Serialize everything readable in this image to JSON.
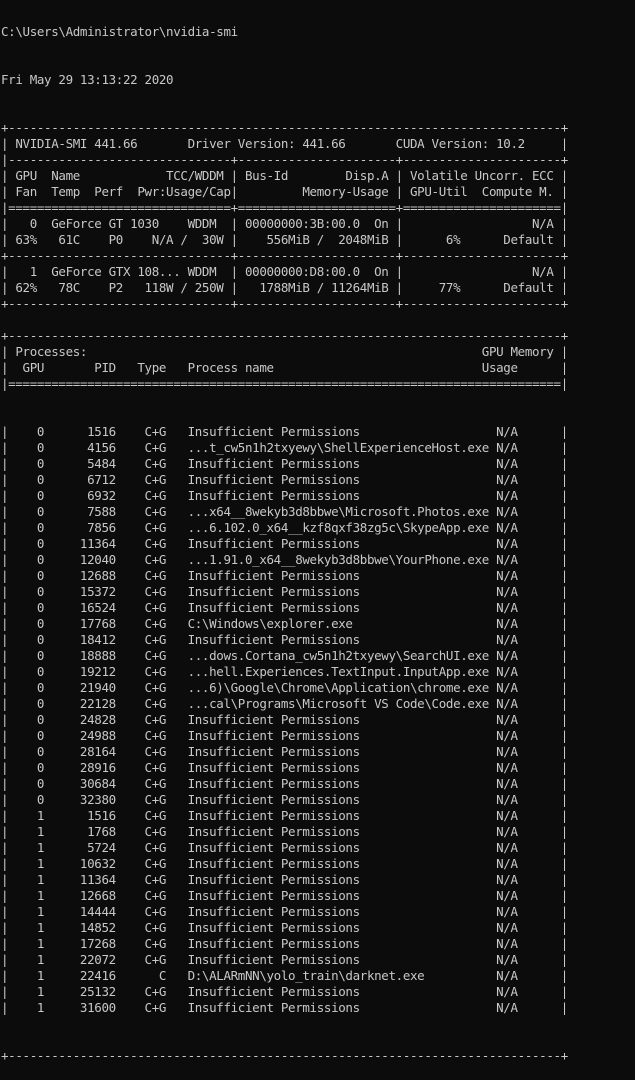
{
  "terminal": {
    "command_line": "C:\\Users\\Administrator\\nvidia-smi",
    "date_line": "Fri May 29 13:13:22 2020",
    "smi_table": [
      "+-----------------------------------------------------------------------------+",
      "| NVIDIA-SMI 441.66       Driver Version: 441.66       CUDA Version: 10.2     |",
      "|-------------------------------+----------------------+----------------------+",
      "| GPU  Name            TCC/WDDM | Bus-Id        Disp.A | Volatile Uncorr. ECC |",
      "| Fan  Temp  Perf  Pwr:Usage/Cap|         Memory-Usage | GPU-Util  Compute M. |",
      "|===============================+======================+======================|",
      "|   0  GeForce GT 1030    WDDM  | 00000000:3B:00.0  On |                  N/A |",
      "| 63%   61C    P0    N/A /  30W |    556MiB /  2048MiB |      6%      Default |",
      "+-------------------------------+----------------------+----------------------+",
      "|   1  GeForce GTX 108... WDDM  | 00000000:D8:00.0  On |                  N/A |",
      "| 62%   78C    P2   118W / 250W |   1788MiB / 11264MiB |     77%      Default |",
      "+-------------------------------+----------------------+----------------------+",
      "",
      "+-----------------------------------------------------------------------------+",
      "| Processes:                                                       GPU Memory |",
      "|  GPU       PID   Type   Process name                             Usage      |",
      "|=============================================================================|"
    ],
    "process_rows": [
      "|    0      1516    C+G   Insufficient Permissions                   N/A      |",
      "|    0      4156    C+G   ...t_cw5n1h2txyewy\\ShellExperienceHost.exe N/A      |",
      "|    0      5484    C+G   Insufficient Permissions                   N/A      |",
      "|    0      6712    C+G   Insufficient Permissions                   N/A      |",
      "|    0      6932    C+G   Insufficient Permissions                   N/A      |",
      "|    0      7588    C+G   ...x64__8wekyb3d8bbwe\\Microsoft.Photos.exe N/A      |",
      "|    0      7856    C+G   ...6.102.0_x64__kzf8qxf38zg5c\\SkypeApp.exe N/A      |",
      "|    0     11364    C+G   Insufficient Permissions                   N/A      |",
      "|    0     12040    C+G   ...1.91.0_x64__8wekyb3d8bbwe\\YourPhone.exe N/A      |",
      "|    0     12688    C+G   Insufficient Permissions                   N/A      |",
      "|    0     15372    C+G   Insufficient Permissions                   N/A      |",
      "|    0     16524    C+G   Insufficient Permissions                   N/A      |",
      "|    0     17768    C+G   C:\\Windows\\explorer.exe                    N/A      |",
      "|    0     18412    C+G   Insufficient Permissions                   N/A      |",
      "|    0     18888    C+G   ...dows.Cortana_cw5n1h2txyewy\\SearchUI.exe N/A      |",
      "|    0     19212    C+G   ...hell.Experiences.TextInput.InputApp.exe N/A      |",
      "|    0     21940    C+G   ...6)\\Google\\Chrome\\Application\\chrome.exe N/A      |",
      "|    0     22128    C+G   ...cal\\Programs\\Microsoft VS Code\\Code.exe N/A      |",
      "|    0     24828    C+G   Insufficient Permissions                   N/A      |",
      "|    0     24988    C+G   Insufficient Permissions                   N/A      |",
      "|    0     28164    C+G   Insufficient Permissions                   N/A      |",
      "|    0     28916    C+G   Insufficient Permissions                   N/A      |",
      "|    0     30684    C+G   Insufficient Permissions                   N/A      |",
      "|    0     32380    C+G   Insufficient Permissions                   N/A      |",
      "|    1      1516    C+G   Insufficient Permissions                   N/A      |",
      "|    1      1768    C+G   Insufficient Permissions                   N/A      |",
      "|    1      5724    C+G   Insufficient Permissions                   N/A      |",
      "|    1     10632    C+G   Insufficient Permissions                   N/A      |",
      "|    1     11364    C+G   Insufficient Permissions                   N/A      |",
      "|    1     12668    C+G   Insufficient Permissions                   N/A      |",
      "|    1     14444    C+G   Insufficient Permissions                   N/A      |",
      "|    1     14852    C+G   Insufficient Permissions                   N/A      |",
      "|    1     17268    C+G   Insufficient Permissions                   N/A      |",
      "|    1     22072    C+G   Insufficient Permissions                   N/A      |",
      "|    1     22416      C   D:\\ALARmNN\\yolo_train\\darknet.exe          N/A      |",
      "|    1     25132    C+G   Insufficient Permissions                   N/A      |",
      "|    1     31600    C+G   Insufficient Permissions                   N/A      |"
    ],
    "table_footer": "+-----------------------------------------------------------------------------+"
  }
}
